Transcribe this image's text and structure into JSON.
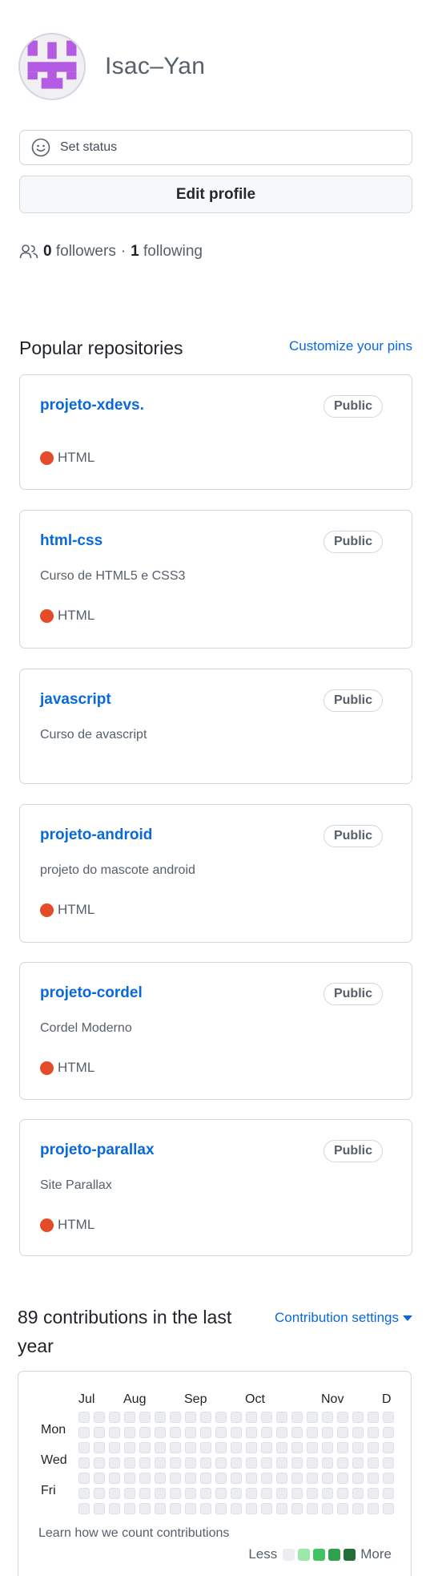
{
  "profile": {
    "username": "Isac–Yan",
    "status_label": "Set status",
    "edit_profile_label": "Edit profile",
    "followers_count": "0",
    "followers_label": "followers",
    "separator": "·",
    "following_count": "1",
    "following_label": "following",
    "avatar_color": "#b45ae3"
  },
  "popular": {
    "title": "Popular repositories",
    "customize_label": "Customize your pins",
    "repos": [
      {
        "name": "projeto-xdevs.",
        "badge": "Public",
        "description": "",
        "language": "HTML"
      },
      {
        "name": "html-css",
        "badge": "Public",
        "description": "Curso de HTML5 e CSS3",
        "language": "HTML"
      },
      {
        "name": "javascript",
        "badge": "Public",
        "description": "Curso de avascript",
        "language": ""
      },
      {
        "name": "projeto-android",
        "badge": "Public",
        "description": "projeto do mascote android",
        "language": "HTML"
      },
      {
        "name": "projeto-cordel",
        "badge": "Public",
        "description": "Cordel Moderno",
        "language": "HTML"
      },
      {
        "name": "projeto-parallax",
        "badge": "Public",
        "description": "Site Parallax",
        "language": "HTML"
      }
    ],
    "language_color": "#e34c26"
  },
  "contributions": {
    "title": "89 contributions in the last year",
    "settings_label": "Contribution settings",
    "months": [
      "Jul",
      "Aug",
      "Sep",
      "Oct",
      "Nov",
      "D"
    ],
    "days": [
      "Mon",
      "Wed",
      "Fri"
    ],
    "learn_label": "Learn how we count contributions",
    "legend_less": "Less",
    "legend_more": "More",
    "legend_colors": [
      "#ebedf0",
      "#9be9a8",
      "#40c463",
      "#30a14e",
      "#216e39"
    ]
  },
  "colors": {
    "link": "#0969da",
    "border": "#d0d7de",
    "muted": "#57606a"
  }
}
